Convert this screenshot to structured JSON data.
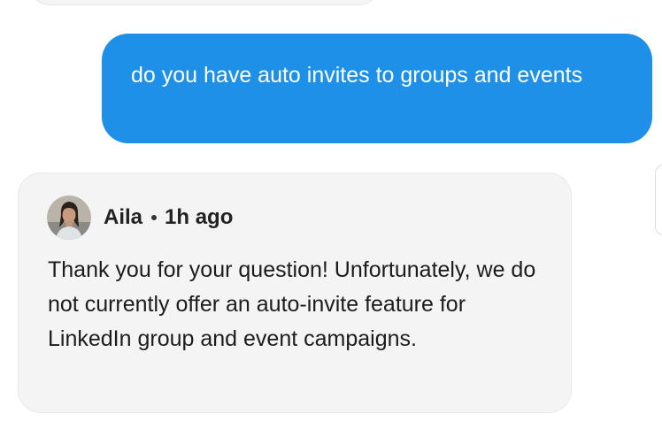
{
  "conversation": {
    "user_message": "do you have auto invites to groups and events",
    "reply": {
      "author": "Aila",
      "separator": "•",
      "time": "1h ago",
      "text": "Thank you for your question! Unfortunately, we do not currently offer an auto-invite feature for LinkedIn group and event campaigns."
    }
  },
  "colors": {
    "user_bubble": "#1f90e8",
    "agent_bubble": "#f4f4f4",
    "page_bg": "#ffffff"
  }
}
